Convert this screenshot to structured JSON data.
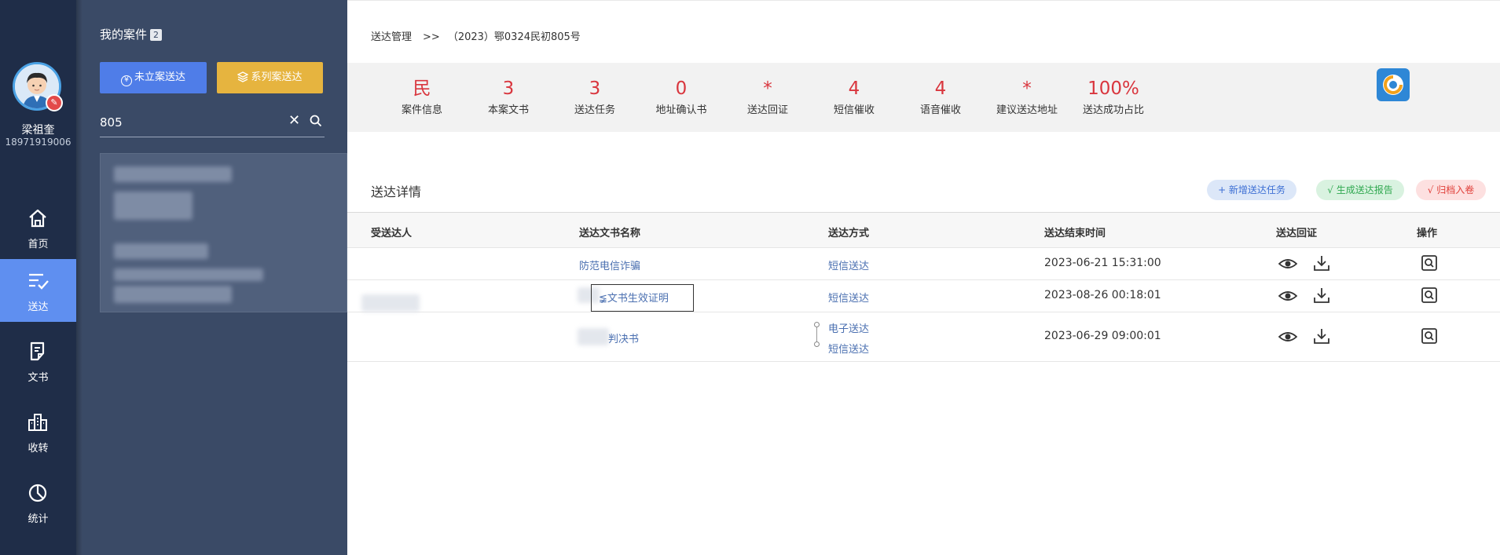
{
  "user": {
    "name": "梁祖奎",
    "phone": "18971919006"
  },
  "nav": [
    {
      "label": "首页",
      "icon": "home-icon",
      "active": false
    },
    {
      "label": "送达",
      "icon": "deliver-check-icon",
      "active": true
    },
    {
      "label": "文书",
      "icon": "document-icon",
      "active": false
    },
    {
      "label": "收转",
      "icon": "building-icon",
      "active": false
    },
    {
      "label": "统计",
      "icon": "pie-chart-icon",
      "active": false
    }
  ],
  "panel": {
    "title": "我的案件",
    "count": "2",
    "btn_unfiled": "未立案送达",
    "btn_series": "系列案送达",
    "search_value": "805"
  },
  "breadcrumb": {
    "root": "送达管理",
    "sep": ">>",
    "case": "（2023）鄂0324民初805号"
  },
  "stats": [
    {
      "value": "民",
      "label": "案件信息"
    },
    {
      "value": "3",
      "label": "本案文书"
    },
    {
      "value": "3",
      "label": "送达任务"
    },
    {
      "value": "0",
      "label": "地址确认书"
    },
    {
      "value": "*",
      "label": "送达回证"
    },
    {
      "value": "4",
      "label": "短信催收"
    },
    {
      "value": "4",
      "label": "语音催收"
    },
    {
      "value": "*",
      "label": "建议送达地址"
    },
    {
      "value": "100%",
      "label": "送达成功占比"
    }
  ],
  "detail": {
    "title": "送达详情",
    "btn_add": "+ 新增送达任务",
    "btn_report": "√ 生成送达报告",
    "btn_archive": "√ 归档入卷"
  },
  "table": {
    "headers": [
      "受送达人",
      "送达文书名称",
      "送达方式",
      "送达结束时间",
      "送达回证",
      "操作"
    ],
    "rows": [
      {
        "doc": "防范电信诈骗",
        "methods": [
          "短信送达"
        ],
        "time": "2023-06-21 15:31:00"
      },
      {
        "doc": "≨文书生效证明",
        "methods": [
          "短信送达"
        ],
        "time": "2023-08-26 00:18:01"
      },
      {
        "doc": "判决书",
        "methods": [
          "电子送达",
          "短信送达"
        ],
        "time": "2023-06-29 09:00:01"
      }
    ]
  },
  "colors": {
    "nav_bg": "#1f2d48",
    "nav_active": "#5f8ff0",
    "panel_bg": "#3a4a66",
    "accent_red": "#d9363e",
    "link": "#4a6fb0"
  }
}
